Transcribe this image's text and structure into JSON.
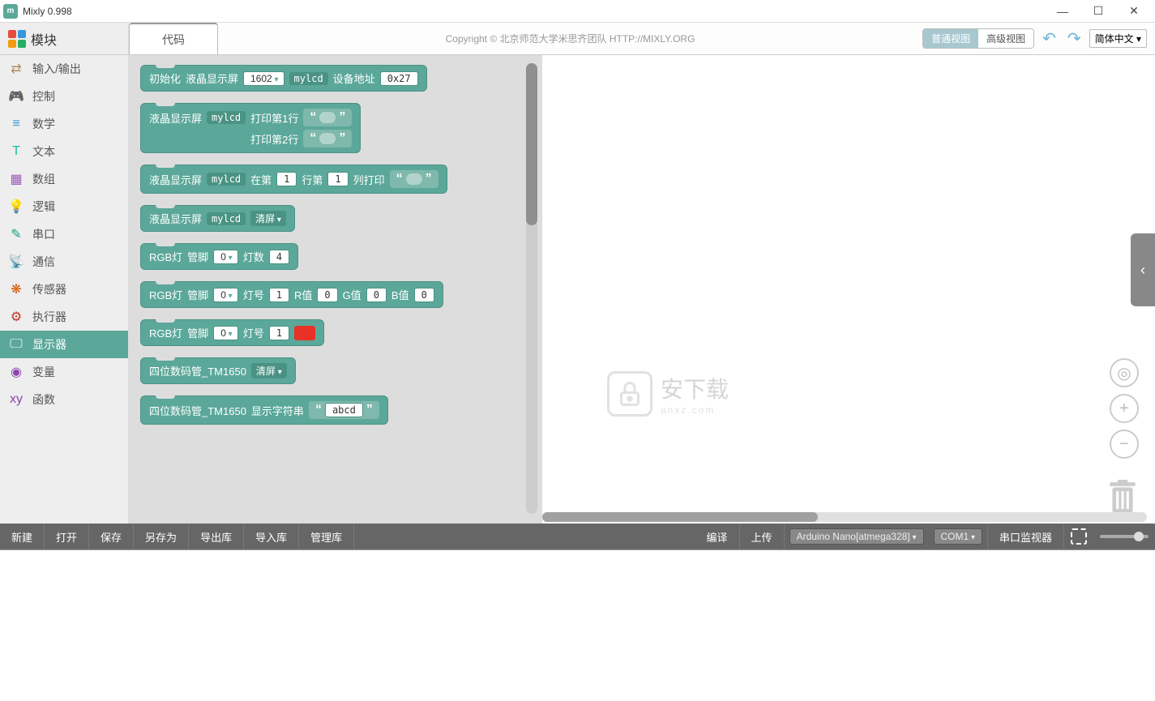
{
  "window": {
    "title": "Mixly 0.998"
  },
  "header": {
    "modules_label": "模块",
    "code_tab": "代码",
    "copyright": "Copyright  ©  北京师范大学米思齐团队 HTTP://MIXLY.ORG",
    "view_normal": "普通视图",
    "view_advanced": "高级视图",
    "language": "简体中文"
  },
  "sidebar": {
    "items": [
      {
        "label": "输入/输出",
        "icon": "⇄",
        "color": "#b08c5f"
      },
      {
        "label": "控制",
        "icon": "🎮",
        "color": "#7fb069"
      },
      {
        "label": "数学",
        "icon": "≡",
        "color": "#3498db"
      },
      {
        "label": "文本",
        "icon": "T",
        "color": "#1abc9c"
      },
      {
        "label": "数组",
        "icon": "▦",
        "color": "#9b59b6"
      },
      {
        "label": "逻辑",
        "icon": "💡",
        "color": "#3498db"
      },
      {
        "label": "串口",
        "icon": "✎",
        "color": "#16a085"
      },
      {
        "label": "通信",
        "icon": "📡",
        "color": "#27ae60"
      },
      {
        "label": "传感器",
        "icon": "❋",
        "color": "#d35400"
      },
      {
        "label": "执行器",
        "icon": "⚙",
        "color": "#c0392b"
      },
      {
        "label": "显示器",
        "icon": "🖵",
        "color": "#fff"
      },
      {
        "label": "变量",
        "icon": "◉",
        "color": "#8e44ad"
      },
      {
        "label": "函数",
        "icon": "xy",
        "color": "#8e44ad"
      }
    ],
    "active_index": 10
  },
  "blocks": {
    "b1": {
      "t1": "初始化",
      "t2": "液晶显示屏",
      "dd1": "1602",
      "field1": "mylcd",
      "t3": "设备地址",
      "field2": "0x27"
    },
    "b2": {
      "t1": "液晶显示屏",
      "field1": "mylcd",
      "t2": "打印第1行",
      "t3": "打印第2行"
    },
    "b3": {
      "t1": "液晶显示屏",
      "field1": "mylcd",
      "t2": "在第",
      "v1": "1",
      "t3": "行第",
      "v2": "1",
      "t4": "列打印"
    },
    "b4": {
      "t1": "液晶显示屏",
      "field1": "mylcd",
      "dd1": "清屏"
    },
    "b5": {
      "t1": "RGB灯",
      "t2": "管脚",
      "dd1": "0",
      "t3": "灯数",
      "v1": "4"
    },
    "b6": {
      "t1": "RGB灯",
      "t2": "管脚",
      "dd1": "0",
      "t3": "灯号",
      "v1": "1",
      "t4": "R值",
      "v2": "0",
      "t5": "G值",
      "v3": "0",
      "t6": "B值",
      "v4": "0"
    },
    "b7": {
      "t1": "RGB灯",
      "t2": "管脚",
      "dd1": "0",
      "t3": "灯号",
      "v1": "1"
    },
    "b8": {
      "t1": "四位数码管_TM1650",
      "dd1": "清屏"
    },
    "b9": {
      "t1": "四位数码管_TM1650",
      "t2": "显示字符串",
      "v1": "abcd"
    }
  },
  "watermark": {
    "cn": "安下载",
    "en": "anxz.com"
  },
  "bottombar": {
    "new": "新建",
    "open": "打开",
    "save": "保存",
    "saveas": "另存为",
    "exportlib": "导出库",
    "importlib": "导入库",
    "managelib": "管理库",
    "compile": "编译",
    "upload": "上传",
    "board": "Arduino Nano[atmega328]",
    "port": "COM1",
    "monitor": "串口监视器"
  }
}
